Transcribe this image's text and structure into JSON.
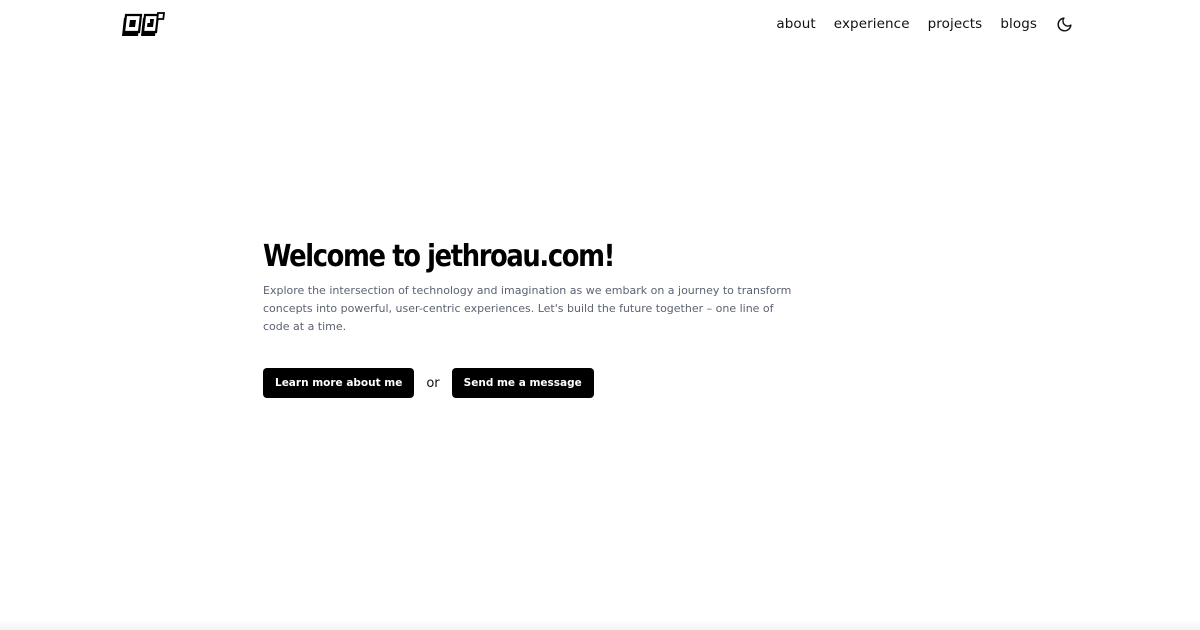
{
  "header": {
    "logo_icon": "oj-monogram-logo-icon",
    "nav": [
      {
        "label": "about"
      },
      {
        "label": "experience"
      },
      {
        "label": "projects"
      },
      {
        "label": "blogs"
      }
    ],
    "theme_toggle_icon": "moon-icon"
  },
  "hero": {
    "title": "Welcome to jethroau.com!",
    "description": "Explore the intersection of technology and imagination as we embark on a journey to transform concepts into powerful, user-centric experiences. Let's build the future together – one line of code at a time.",
    "primary_cta": "Learn more about me",
    "separator": "or",
    "secondary_cta": "Send me a message"
  },
  "colors": {
    "background": "#ffffff",
    "text": "#111111",
    "muted_text": "#5c6273",
    "button_bg": "#000000",
    "button_text": "#ffffff"
  }
}
